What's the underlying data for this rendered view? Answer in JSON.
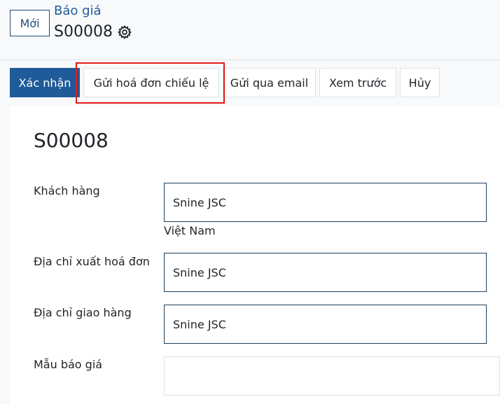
{
  "header": {
    "new_button": "Mới",
    "breadcrumb": "Báo giá",
    "record_name": "S00008",
    "gear_icon": "gear-icon"
  },
  "actions": {
    "confirm": "Xác nhận",
    "send_proforma": "Gửi hoá đơn chiếu lệ",
    "send_email": "Gửi qua email",
    "preview": "Xem trước",
    "cancel": "Hủy"
  },
  "form": {
    "title": "S00008",
    "customer_label": "Khách hàng",
    "customer_value": "Snine JSC",
    "customer_country": "Việt Nam",
    "invoice_address_label": "Địa chỉ xuất hoá đơn",
    "invoice_address_value": "Snine JSC",
    "delivery_address_label": "Địa chỉ giao hàng",
    "delivery_address_value": "Snine JSC",
    "quotation_template_label": "Mẫu báo giá",
    "quotation_template_value": ""
  },
  "colors": {
    "primary": "#1f5a99",
    "highlight": "#e01b1b"
  }
}
